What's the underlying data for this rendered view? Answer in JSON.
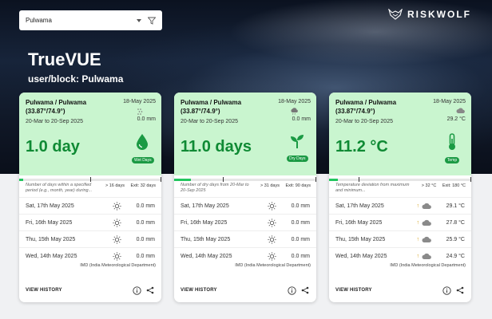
{
  "search": {
    "value": "Pulwama"
  },
  "brand": {
    "name": "RISKWOLF"
  },
  "hero": {
    "title": "TrueVUE",
    "subtitle": "user/block: Pulwama"
  },
  "cards": [
    {
      "location": "Pulwama / Pulwama (33.87°/74.9°)",
      "date": "18-May 2025",
      "range": "20-Mar to 20-Sep 2025",
      "range_value": "0.0 mm",
      "big_value": "1.0 day",
      "badge": "Wet Days",
      "badge_icon": "water-drop-icon",
      "progress": 0.03,
      "description": "Number of days within a specified period (e.g., month, year) during...",
      "threshold": "> 16 days",
      "exit": "Exit: 32 days",
      "rows": [
        {
          "date": "Sat, 17th May 2025",
          "icon": "sun-icon",
          "value": "0.0 mm"
        },
        {
          "date": "Fri, 16th May 2025",
          "icon": "sun-icon",
          "value": "0.0 mm"
        },
        {
          "date": "Thu, 15th May 2025",
          "icon": "sun-icon",
          "value": "0.0 mm"
        },
        {
          "date": "Wed, 14th May 2025",
          "icon": "sun-icon",
          "value": "0.0 mm"
        }
      ],
      "source": "IMD (India Meteorological Department)",
      "view_history": "VIEW HISTORY"
    },
    {
      "location": "Pulwama / Pulwama (33.87°/74.9°)",
      "date": "18-May 2025",
      "range": "20-Mar to 20-Sep 2025",
      "range_value": "0.0 mm",
      "big_value": "11.0 days",
      "badge": "Dry Days",
      "badge_icon": "sprout-icon",
      "progress": 0.12,
      "description": "Number of dry days from 20-Mar to 20-Sep 2025",
      "threshold": "> 31 days",
      "exit": "Exit: 90 days",
      "rows": [
        {
          "date": "Sat, 17th May 2025",
          "icon": "sun-icon",
          "value": "0.0 mm"
        },
        {
          "date": "Fri, 16th May 2025",
          "icon": "sun-icon",
          "value": "0.0 mm"
        },
        {
          "date": "Thu, 15th May 2025",
          "icon": "sun-icon",
          "value": "0.0 mm"
        },
        {
          "date": "Wed, 14th May 2025",
          "icon": "sun-icon",
          "value": "0.0 mm"
        }
      ],
      "source": "IMD (India Meteorological Department)",
      "view_history": "VIEW HISTORY"
    },
    {
      "location": "Pulwama / Pulwama (33.87°/74.9°)",
      "date": "18-May 2025",
      "range": "20-Mar to 20-Sep 2025",
      "range_value": "29.2 °C",
      "big_value": "11.2 °C",
      "badge": "Temp",
      "badge_icon": "thermometer-icon",
      "progress": 0.06,
      "description": "Temperature deviation from maximum and minimum...",
      "threshold": "> 32 °C",
      "exit": "Exit: 180 °C",
      "rows": [
        {
          "date": "Sat, 17th May 2025",
          "icon": "cloud-icon",
          "value": "29.1 °C"
        },
        {
          "date": "Fri, 16th May 2025",
          "icon": "cloud-icon",
          "value": "27.8 °C"
        },
        {
          "date": "Thu, 15th May 2025",
          "icon": "cloud-icon",
          "value": "25.9 °C"
        },
        {
          "date": "Wed, 14th May 2025",
          "icon": "cloud-icon",
          "value": "24.9 °C"
        }
      ],
      "source": "IMD (India Meteorological Department)",
      "view_history": "VIEW HISTORY"
    }
  ],
  "colors": {
    "card_top": "#c9f5cf",
    "accent": "#0f8a34",
    "progress": "#22c55e",
    "badge": "#1b9a44"
  }
}
